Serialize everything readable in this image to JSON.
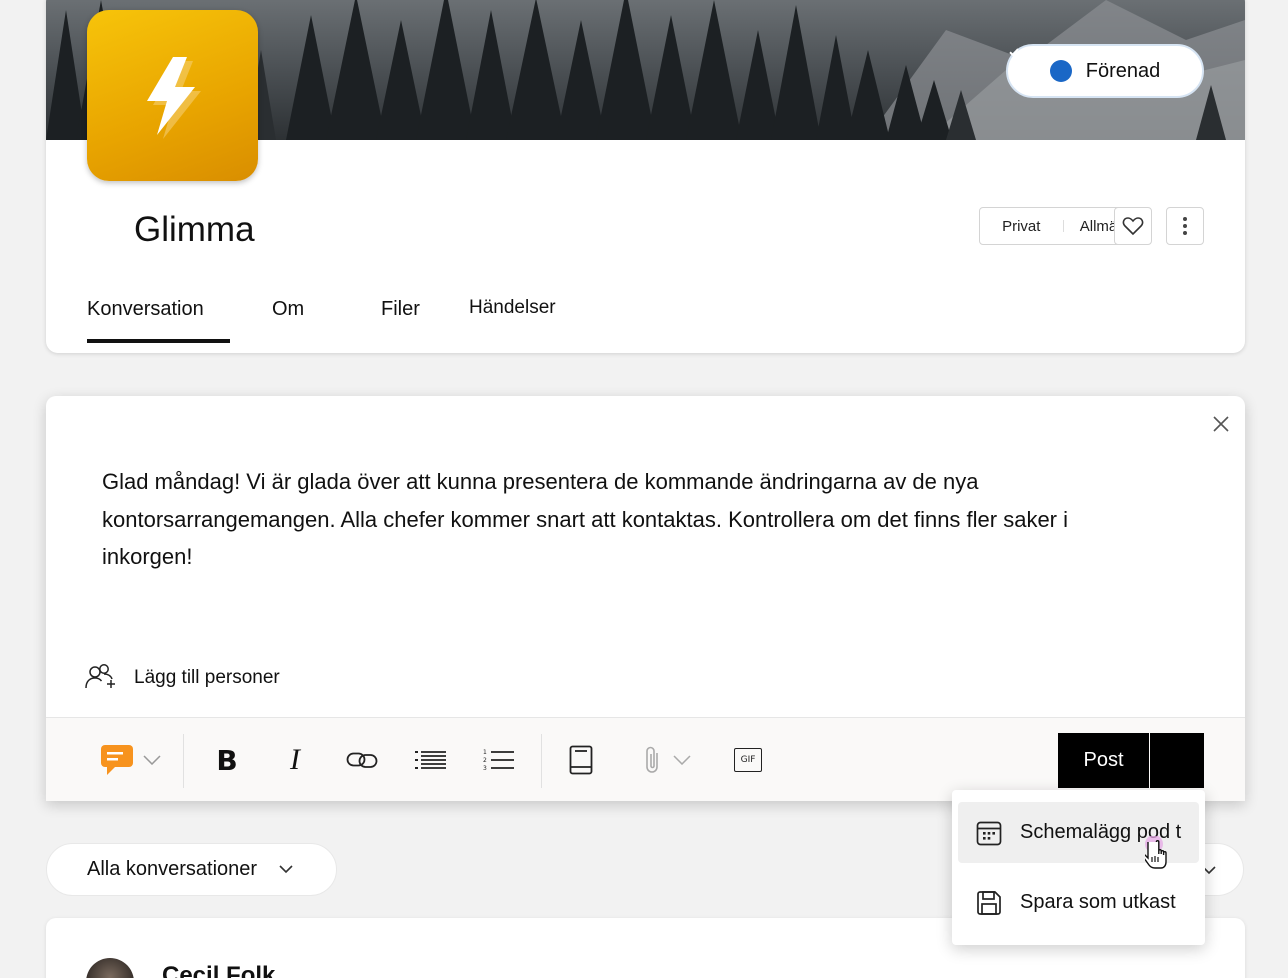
{
  "community": {
    "name": "Glimma",
    "joined_label": "Förenad",
    "privacy": {
      "private_label": "Privat",
      "public_label": "Allmänt"
    },
    "tabs": [
      {
        "label": "Konversation",
        "active": true
      },
      {
        "label": "Om",
        "active": false
      },
      {
        "label": "Filer",
        "active": false
      },
      {
        "label": "Händelser",
        "active": false
      }
    ]
  },
  "composer": {
    "message": "Glad måndag! Vi är glada över att kunna presentera de kommande ändringarna av de nya kontorsarrangemangen. Alla chefer kommer snart att kontaktas. Kontrollera om det finns fler saker i inkorgen!",
    "add_people_label": "Lägg till personer",
    "toolbar": {
      "post_type_icon": "praise-chat-icon",
      "bold_label": "B",
      "italic_label": "I",
      "gif_label": "GIF"
    },
    "post_label": "Post"
  },
  "post_menu": {
    "items": [
      {
        "label": "Schemalägg pod t",
        "icon": "calendar-icon",
        "hovered": true
      },
      {
        "label": "Spara som utkast",
        "icon": "save-icon",
        "hovered": false
      }
    ]
  },
  "feed": {
    "filter_label": "Alla konversationer",
    "first_post_author": "Cecil Folk"
  },
  "colors": {
    "accent_blue": "#1a67c6",
    "logo_yellow": "#f2b600",
    "post_type_orange": "#f7931e",
    "primary_button": "#000000"
  }
}
